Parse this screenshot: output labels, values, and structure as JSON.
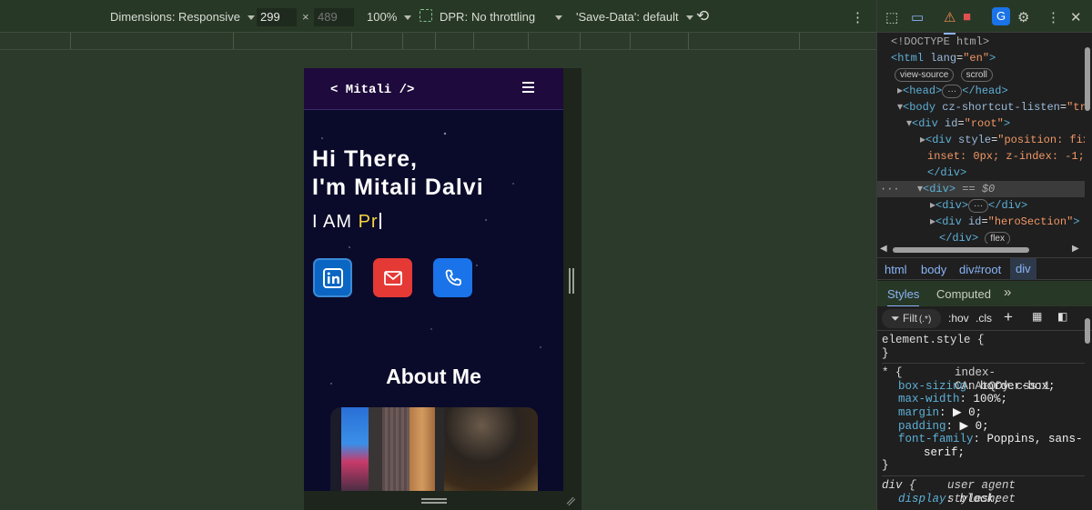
{
  "toolbar": {
    "dimensions_label": "Dimensions:",
    "dimensions_value": "Responsive",
    "width": "299",
    "times": "×",
    "height": "489",
    "zoom": "100%",
    "dpr_label": "DPR:",
    "throttling": "No throttling",
    "save_data": "'Save-Data': default",
    "more": "⋮"
  },
  "site": {
    "logo": "< Mitali />",
    "hero_line1": "Hi There,",
    "hero_line2": "I'm Mitali Dalvi",
    "sub_prefix": "I AM ",
    "sub_typed": "Pr",
    "about_title": "About Me",
    "colors": {
      "nav": "#1e0a3c",
      "bg": "#0a0a2a",
      "linkedin": "#0a66c2",
      "mail": "#e53935",
      "phone": "#1a73e8",
      "typed": "#f5d442"
    },
    "social": [
      {
        "name": "linkedin-icon",
        "glyph": "in"
      },
      {
        "name": "mail-icon",
        "glyph": "✉"
      },
      {
        "name": "phone-icon",
        "glyph": "✆"
      }
    ]
  },
  "devtools": {
    "dom": {
      "doctype": "<!DOCTYPE html>",
      "html_open": "<html",
      "lang_attr": "lang",
      "lang_val": "\"en\"",
      "close_gt": ">",
      "view_source": "view-source",
      "scroll": "scroll",
      "head": "<head>",
      "head_close": "</head>",
      "body_open": "<body",
      "body_attr": "cz-shortcut-listen",
      "body_val": "\"tru",
      "div_root": "<div",
      "id_attr": "id",
      "root_val": "\"root\"",
      "style_attr": "style",
      "style_val": "\"position: fix",
      "style_cont": "inset: 0px; z-index: -1;\"",
      "div_close": "</div>",
      "div_sel": "<div>",
      "sel_eq": "== $0",
      "div_inner": "<div>",
      "hero_val": "\"heroSection\"",
      "flex": "flex",
      "ellipsis": "…",
      "dots": "···"
    },
    "breadcrumbs": [
      "html",
      "body",
      "div#root",
      "div"
    ],
    "tabs": {
      "styles": "Styles",
      "computed": "Computed",
      "more": "»"
    },
    "filter": {
      "placeholder": "Filt",
      "regex": "(.*)",
      "hov": ":hov",
      "cls": ".cls",
      "plus": "+"
    },
    "styles": {
      "element_style": "element.style {",
      "close": "}",
      "star_selector": "* {",
      "source": "index-CAnAtQDy.css:1",
      "rules": [
        {
          "prop": "box-sizing",
          "val": "border-box;"
        },
        {
          "prop": "max-width",
          "val": "100%;"
        },
        {
          "prop": "margin",
          "val": "▶ 0;"
        },
        {
          "prop": "padding",
          "val": "▶ 0;"
        },
        {
          "prop": "font-family",
          "val": "Poppins, sans-"
        }
      ],
      "font_cont": "serif;",
      "div_selector": "div {",
      "ua": "user agent stylesheet",
      "display_prop": "display",
      "display_val": "block;"
    }
  }
}
